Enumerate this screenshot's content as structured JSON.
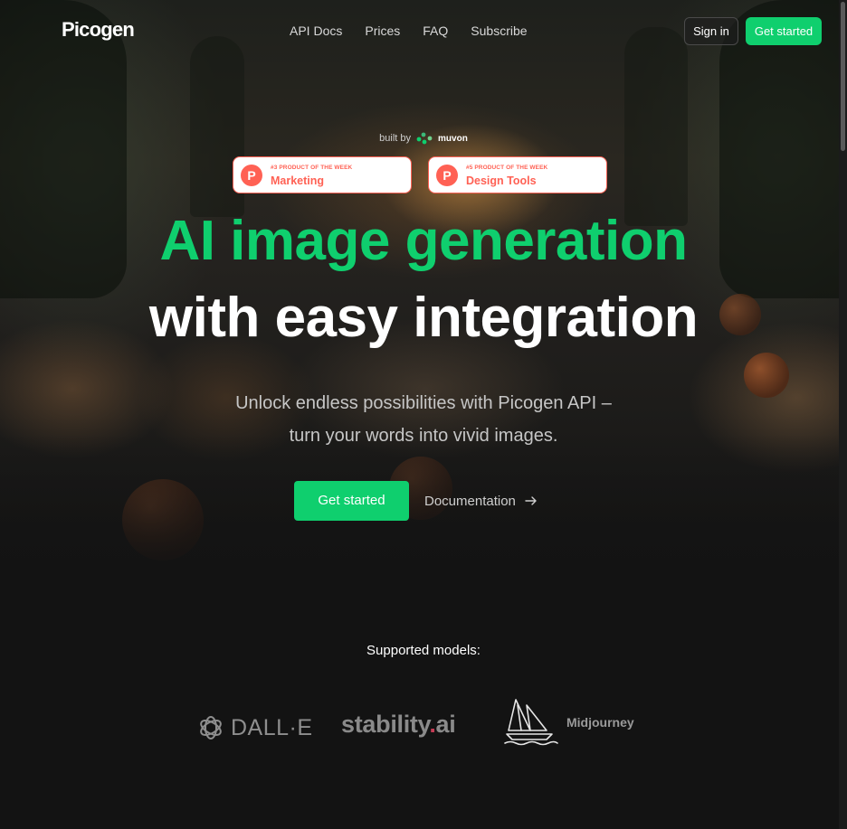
{
  "header": {
    "logo": "Picogen",
    "nav": [
      "API Docs",
      "Prices",
      "FAQ",
      "Subscribe"
    ],
    "signin_label": "Sign in",
    "cta_label": "Get started"
  },
  "builtby": {
    "prefix": "built by",
    "brand": "muvon"
  },
  "badges": [
    {
      "rank": "#3 PRODUCT OF THE WEEK",
      "category": "Marketing",
      "icon_letter": "P"
    },
    {
      "rank": "#5 PRODUCT OF THE WEEK",
      "category": "Design Tools",
      "icon_letter": "P"
    }
  ],
  "hero": {
    "headline_1": "AI image generation",
    "headline_2": "with easy integration",
    "subtitle_1": "Unlock endless possibilities with Picogen API –",
    "subtitle_2": "turn your words into vivid images.",
    "cta_label": "Get started",
    "doc_label": "Documentation"
  },
  "models": {
    "title": "Supported models:",
    "dalle": "DALL·E",
    "stability_a": "stability",
    "stability_dot": ".",
    "stability_b": "ai",
    "midjourney": "Midjourney"
  },
  "colors": {
    "accent": "#0fcf6e",
    "producthunt": "#ff6154",
    "background": "#131313"
  }
}
